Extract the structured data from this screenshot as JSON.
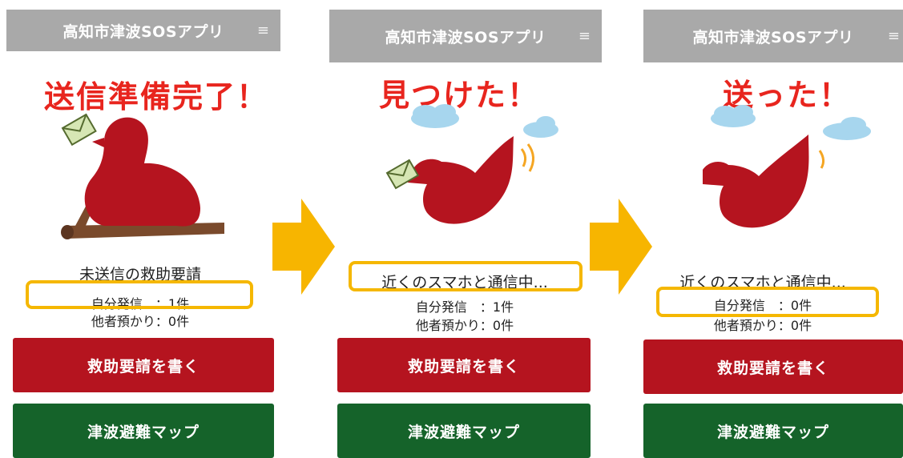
{
  "app_title": "高知市津波SOSアプリ",
  "menu_icon": "≡",
  "panels": [
    {
      "caption": "送信準備完了！",
      "status": "未送信の救助要請",
      "self_count": "自分発信　：1件",
      "others_count": "他者預かり：0件",
      "btn_write": "救助要請を書く",
      "btn_map": "津波避難マップ"
    },
    {
      "caption": "見つけた！",
      "status": "近くのスマホと通信中...",
      "self_count": "自分発信　：1件",
      "others_count": "他者預かり：0件",
      "btn_write": "救助要請を書く",
      "btn_map": "津波避難マップ"
    },
    {
      "caption": "送った！",
      "status": "近くのスマホと通信中...",
      "self_count": "自分発信　：0件",
      "others_count": "他者預かり：0件",
      "btn_write": "救助要請を書く",
      "btn_map": "津波避難マップ"
    }
  ],
  "colors": {
    "header": "#a9a9a9",
    "caption": "#e8251e",
    "bird": "#b5141f",
    "highlight": "#f5b700",
    "button_red": "#b5141f",
    "button_green": "#15632a",
    "arrow": "#f7b500"
  }
}
